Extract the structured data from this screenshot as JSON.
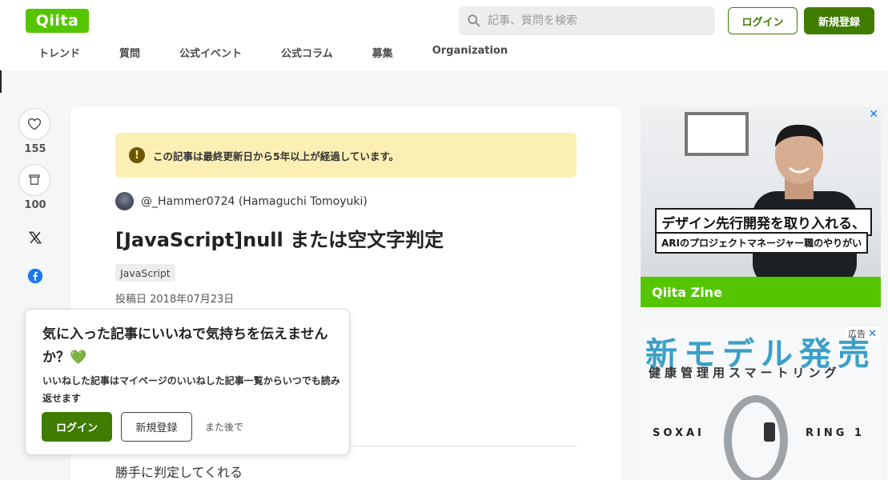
{
  "header": {
    "logo": "Qiita",
    "search_placeholder": "記事、質問を検索",
    "login": "ログイン",
    "signup": "新規登録",
    "nav": [
      "トレンド",
      "質問",
      "公式イベント",
      "公式コラム",
      "募集",
      "Organization"
    ]
  },
  "side": {
    "likes": "155",
    "stocks": "100"
  },
  "article": {
    "notice": "この記事は最終更新日から5年以上が経過しています。",
    "author": "@_Hammer0724 (Hamaguchi Tomoyuki)",
    "title": "[JavaScript]null または空文字判定",
    "tag": "JavaScript",
    "posted": "投稿日 2018年07月23日",
    "body_first_line": "勝手に判定してくれる"
  },
  "popup": {
    "heading": "気に入った記事にいいねで気持ちを伝えませんか？💚",
    "text": "いいねした記事はマイページのいいねした記事一覧からいつでも読み返せます",
    "login": "ログイン",
    "signup": "新規登録",
    "later": "また後で"
  },
  "ad1": {
    "caption1": "デザイン先行開発を取り入れる、",
    "caption2": "ARIのプロジェクトマネージャー職のやりがい",
    "brand": "Qiita Zine",
    "close": "✕"
  },
  "ad2": {
    "label": "広告",
    "close": "✕",
    "headline": "新モデル発売",
    "subline": "健康管理用スマートリング",
    "brand_left": "SOXAI",
    "brand_right": "RING 1"
  },
  "colors": {
    "brand_green": "#55c500",
    "dark_green": "#3f7c00",
    "notice_bg": "#fcefb4"
  }
}
